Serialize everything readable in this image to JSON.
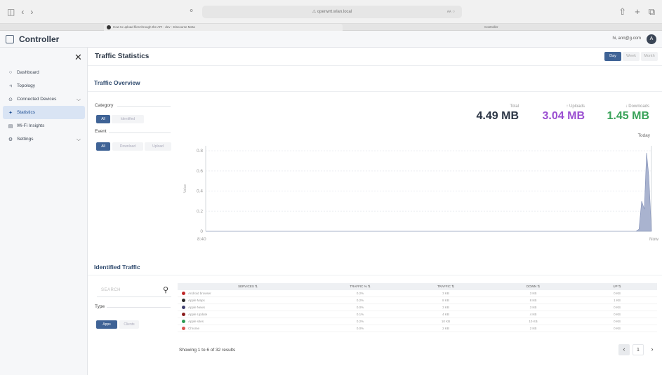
{
  "browser": {
    "url": "⚠ openwrt.wlan.local",
    "reader": "ᴀᴀ ○",
    "tabs": [
      "How to upload files through the API - dev - Discourse Meta",
      "Controller"
    ]
  },
  "app": {
    "title": "Controller",
    "user_email": "hi, ann@g.com",
    "avatar_initial": "A"
  },
  "sidebar": {
    "items": [
      {
        "label": "Dashboard",
        "icon": "○",
        "icon_name": "dashboard-icon",
        "chevron": ""
      },
      {
        "label": "Topology",
        "icon": "⫣",
        "icon_name": "topology-icon",
        "chevron": ""
      },
      {
        "label": "Connected Devices",
        "icon": "⊙",
        "icon_name": "devices-icon",
        "chevron": "⌵"
      },
      {
        "label": "Statistics",
        "icon": "✦",
        "icon_name": "statistics-icon",
        "chevron": "",
        "active": true
      },
      {
        "label": "Wi-Fi Insights",
        "icon": "▤",
        "icon_name": "wifi-insights-icon",
        "chevron": ""
      },
      {
        "label": "Settings",
        "icon": "⚙",
        "icon_name": "settings-icon",
        "chevron": "⌵"
      }
    ]
  },
  "header": {
    "title": "Traffic Statistics",
    "ranges": [
      "Day",
      "Week",
      "Month"
    ],
    "active_range": "Day"
  },
  "overview": {
    "title": "Traffic Overview",
    "category_label": "Category",
    "category_options": [
      "All",
      "Identified"
    ],
    "event_label": "Event",
    "event_options": [
      "All",
      "Download",
      "Upload"
    ],
    "stats": {
      "total_label": "Total",
      "total_value": "4.49 MB",
      "uploads_label": "↑ Uploads",
      "uploads_value": "3.04 MB",
      "downloads_label": "↓ Downloads",
      "downloads_value": "1.45 MB"
    },
    "period_label": "Today"
  },
  "colors": {
    "accent": "#3f6396",
    "total": "#2c3646",
    "uploads": "#9b4fd1",
    "downloads": "#3aa35a",
    "chart_fill": "#a9b3cf"
  },
  "chart_data": {
    "type": "area",
    "title": "",
    "xlabel": "",
    "ylabel": "Value",
    "x_ticks": [
      "8:40",
      "Now"
    ],
    "y_ticks": [
      "0",
      "0.2",
      "0.4",
      "0.6",
      "0.8"
    ],
    "ylim": [
      0,
      0.85
    ],
    "grid": true,
    "series": [
      {
        "x": [
          0.0,
          0.965,
          0.972,
          0.978,
          0.984,
          0.989,
          0.994,
          1.0
        ],
        "values": [
          0,
          0,
          0.02,
          0.3,
          0.22,
          0.78,
          0.55,
          0
        ]
      }
    ]
  },
  "identified": {
    "title": "Identified Traffic",
    "search_placeholder": "SEARCH",
    "type_label": "Type",
    "type_options": [
      "Apps",
      "Clients"
    ],
    "columns": [
      "SERVICES ⇅",
      "TRAFFIC % ⇅",
      "TRAFFIC ⇅",
      "DOWN ⇅",
      "UP ⇅"
    ],
    "rows": [
      {
        "service": "Android browser",
        "color": "#c02828",
        "pct": "0.2%",
        "traffic": "3 KB",
        "down": "3 KB",
        "up": "0 KB"
      },
      {
        "service": "Apple Maps",
        "color": "#2b2b2b",
        "pct": "0.2%",
        "traffic": "8 KB",
        "down": "8 KB",
        "up": "1 KB"
      },
      {
        "service": "Apple News",
        "color": "#3f3f6e",
        "pct": "0.0%",
        "traffic": "3 KB",
        "down": "3 KB",
        "up": "0 KB"
      },
      {
        "service": "Apple Update",
        "color": "#8a1c1c",
        "pct": "0.1%",
        "traffic": "4 KB",
        "down": "4 KB",
        "up": "0 KB"
      },
      {
        "service": "Apple sites",
        "color": "#2d9c55",
        "pct": "0.2%",
        "traffic": "10 KB",
        "down": "10 KB",
        "up": "0 KB"
      },
      {
        "service": "Chrome",
        "color": "#d9534f",
        "pct": "0.0%",
        "traffic": "2 KB",
        "down": "2 KB",
        "up": "0 KB"
      }
    ],
    "results_text": "Showing 1 to 6 of 32 results",
    "current_page": "1"
  }
}
